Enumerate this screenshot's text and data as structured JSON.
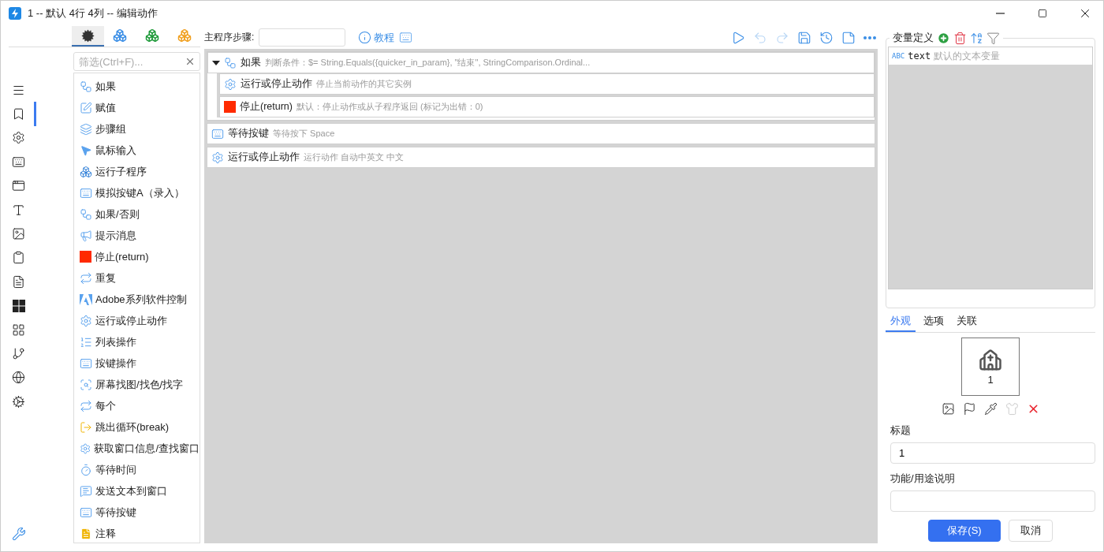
{
  "window": {
    "title": "1 -- 默认 4行 4列 -- 编辑动作"
  },
  "rail": [
    {
      "kind": "menu",
      "selected": false
    },
    {
      "kind": "bookmark",
      "selected": true
    },
    {
      "kind": "gear",
      "selected": false
    },
    {
      "kind": "keyboard",
      "selected": false
    },
    {
      "kind": "window",
      "selected": false
    },
    {
      "kind": "font",
      "selected": false
    },
    {
      "kind": "image",
      "selected": false
    },
    {
      "kind": "clipboard",
      "selected": false
    },
    {
      "kind": "file",
      "selected": false
    },
    {
      "kind": "windows",
      "selected": false
    },
    {
      "kind": "grid",
      "selected": false
    },
    {
      "kind": "branch",
      "selected": false
    },
    {
      "kind": "globe",
      "selected": false
    },
    {
      "kind": "gears",
      "selected": false
    }
  ],
  "rail_bottom": {
    "kind": "wrench"
  },
  "library_tabs": [
    {
      "kind": "gears",
      "color": "#333333",
      "selected": true
    },
    {
      "kind": "cubes",
      "color": "#3a8ee6",
      "selected": false
    },
    {
      "kind": "cubes",
      "color": "#1f9a3a",
      "selected": false
    },
    {
      "kind": "cubes",
      "color": "#f0a020",
      "selected": false
    }
  ],
  "filter": {
    "placeholder": "筛选(Ctrl+F)..."
  },
  "actions": [
    {
      "kind": "branch",
      "label": "如果"
    },
    {
      "kind": "edit",
      "label": "赋值"
    },
    {
      "kind": "layers",
      "label": "步骤组"
    },
    {
      "kind": "pointer",
      "label": "鼠标输入"
    },
    {
      "kind": "cubes",
      "label": "运行子程序"
    },
    {
      "kind": "keyboard",
      "label": "模拟按键A（录入）"
    },
    {
      "kind": "branch",
      "label": "如果/否则"
    },
    {
      "kind": "megaphone",
      "label": "提示消息"
    },
    {
      "kind": "stop",
      "label": "停止(return)"
    },
    {
      "kind": "repeat",
      "label": "重复"
    },
    {
      "kind": "adobe",
      "label": "Adobe系列软件控制"
    },
    {
      "kind": "gear",
      "label": "运行或停止动作"
    },
    {
      "kind": "list",
      "label": "列表操作"
    },
    {
      "kind": "keyboard",
      "label": "按键操作"
    },
    {
      "kind": "search",
      "label": "屏幕找图/找色/找字"
    },
    {
      "kind": "repeat",
      "label": "每个"
    },
    {
      "kind": "exit",
      "label": "跳出循环(break)"
    },
    {
      "kind": "gear",
      "label": "获取窗口信息/查找窗口"
    },
    {
      "kind": "timer",
      "label": "等待时间"
    },
    {
      "kind": "message",
      "label": "发送文本到窗口"
    },
    {
      "kind": "keyboard",
      "label": "等待按键"
    },
    {
      "kind": "note",
      "label": "注释"
    }
  ],
  "editor": {
    "steps_label": "主程序步骤:",
    "tutorial": "教程",
    "toolbar": [
      {
        "kind": "play",
        "disabled": false
      },
      {
        "kind": "undo",
        "disabled": true
      },
      {
        "kind": "redo",
        "disabled": true
      },
      {
        "kind": "save",
        "disabled": false
      },
      {
        "kind": "history",
        "disabled": false
      },
      {
        "kind": "note",
        "disabled": false
      },
      {
        "kind": "more",
        "disabled": false
      }
    ],
    "steps": [
      {
        "kind": "branch",
        "title": "如果",
        "detail": "判断条件：$= String.Equals({quicker_in_param}, \"结束\", StringComparison.Ordinal...",
        "expanded": true,
        "children": [
          {
            "kind": "gear",
            "title": "运行或停止动作",
            "detail": "停止当前动作的其它实例"
          },
          {
            "kind": "stop",
            "title": "停止(return)",
            "detail": "默认：停止动作或从子程序返回 (标记为出错：0)"
          }
        ]
      },
      {
        "kind": "keyboard",
        "title": "等待按键",
        "detail": "等待按下 Space"
      },
      {
        "kind": "gear",
        "title": "运行或停止动作",
        "detail": "运行动作 自动中英文 中文"
      }
    ]
  },
  "variables": {
    "title": "变量定义",
    "items": [
      {
        "type": "ABC",
        "name": "text",
        "description": "默认的文本变量"
      }
    ]
  },
  "settings_tabs": [
    {
      "label": "外观",
      "selected": true
    },
    {
      "label": "选项",
      "selected": false
    },
    {
      "label": "关联",
      "selected": false
    }
  ],
  "preview": {
    "label": "1"
  },
  "icon_tools": [
    {
      "kind": "image",
      "disabled": false
    },
    {
      "kind": "flag",
      "disabled": false
    },
    {
      "kind": "pipette",
      "disabled": false
    },
    {
      "kind": "shirt",
      "disabled": true
    },
    {
      "kind": "delete",
      "disabled": false
    }
  ],
  "form": [
    {
      "label": "标题",
      "value": "1"
    },
    {
      "label": "功能/用途说明"
    }
  ],
  "buttons": [
    {
      "label": "保存(S)",
      "kind": "primary"
    },
    {
      "label": "取消",
      "kind": "secondary"
    }
  ]
}
